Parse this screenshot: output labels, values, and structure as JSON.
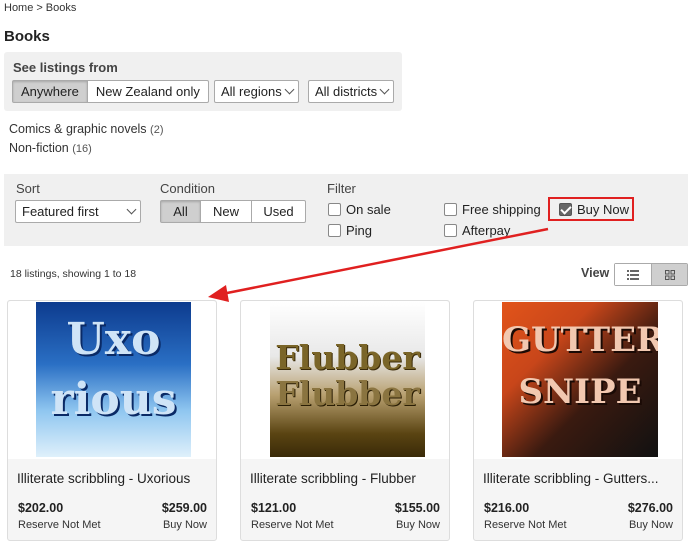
{
  "breadcrumb": {
    "home": "Home",
    "separator": ">",
    "current": "Books"
  },
  "page_title": "Books",
  "region": {
    "label": "See listings from",
    "scope_options": [
      "Anywhere",
      "New Zealand only"
    ],
    "scope_selected": "Anywhere",
    "regions_select": "All regions",
    "districts_select": "All districts"
  },
  "categories": [
    {
      "name": "Comics & graphic novels",
      "count": "(2)"
    },
    {
      "name": "Non-fiction",
      "count": "(16)"
    }
  ],
  "filters": {
    "sort_label": "Sort",
    "sort_value": "Featured first",
    "condition_label": "Condition",
    "condition_options": [
      "All",
      "New",
      "Used"
    ],
    "condition_selected": "All",
    "filter_label": "Filter",
    "checkboxes": {
      "on_sale": {
        "label": "On sale",
        "checked": false
      },
      "ping": {
        "label": "Ping",
        "checked": false
      },
      "free_shipping": {
        "label": "Free shipping",
        "checked": false
      },
      "afterpay": {
        "label": "Afterpay",
        "checked": false
      },
      "buy_now": {
        "label": "Buy Now",
        "checked": true
      }
    }
  },
  "results": {
    "count_text": "18 listings, showing 1 to 18",
    "view_label": "View",
    "view_modes": [
      "list-icon",
      "grid-icon"
    ],
    "view_selected": "grid-icon"
  },
  "listings": [
    {
      "title": "Illiterate scribbling - Uxorious",
      "price": "$202.00",
      "price_label": "Reserve Not Met",
      "buy_now_price": "$259.00",
      "buy_now_label": "Buy Now",
      "image_text_1": "Uxo",
      "image_text_2": "rious"
    },
    {
      "title": "Illiterate scribbling - Flubber",
      "price": "$121.00",
      "price_label": "Reserve Not Met",
      "buy_now_price": "$155.00",
      "buy_now_label": "Buy Now",
      "image_text_1": "Flubber",
      "image_text_2": "Flubber"
    },
    {
      "title": "Illiterate scribbling - Gutters...",
      "price": "$216.00",
      "price_label": "Reserve Not Met",
      "buy_now_price": "$276.00",
      "buy_now_label": "Buy Now",
      "image_text_1": "GUTTER",
      "image_text_2": "SNIPE"
    }
  ],
  "colors": {
    "highlight": "#e02020",
    "panel": "#f0f0f0",
    "active_segment": "#cfcfcf"
  }
}
